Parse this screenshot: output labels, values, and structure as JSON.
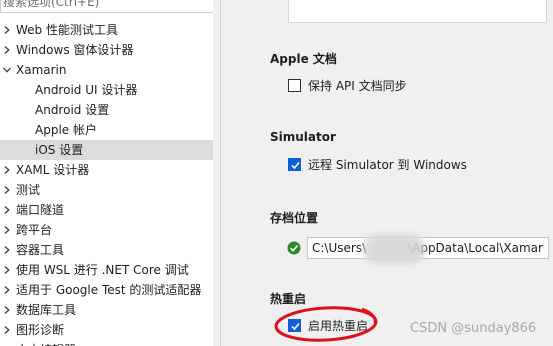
{
  "search": {
    "placeholder": "搜索选项(Ctrl+E)"
  },
  "tree": [
    {
      "label": "Web 性能测试工具",
      "expand": "collapsed",
      "level": 0
    },
    {
      "label": "Windows 窗体设计器",
      "expand": "collapsed",
      "level": 0
    },
    {
      "label": "Xamarin",
      "expand": "expanded",
      "level": 0
    },
    {
      "label": "Android UI 设计器",
      "expand": "none",
      "level": 1
    },
    {
      "label": "Android 设置",
      "expand": "none",
      "level": 1
    },
    {
      "label": "Apple 帐户",
      "expand": "none",
      "level": 1
    },
    {
      "label": "iOS 设置",
      "expand": "none",
      "level": 1,
      "selected": true
    },
    {
      "label": "XAML 设计器",
      "expand": "collapsed",
      "level": 0
    },
    {
      "label": "测试",
      "expand": "collapsed",
      "level": 0
    },
    {
      "label": "端口隧道",
      "expand": "collapsed",
      "level": 0
    },
    {
      "label": "跨平台",
      "expand": "collapsed",
      "level": 0
    },
    {
      "label": "容器工具",
      "expand": "collapsed",
      "level": 0
    },
    {
      "label": "使用 WSL 进行 .NET Core 调试",
      "expand": "collapsed",
      "level": 0
    },
    {
      "label": "适用于 Google Test 的测试适配器",
      "expand": "collapsed",
      "level": 0
    },
    {
      "label": "数据库工具",
      "expand": "collapsed",
      "level": 0
    },
    {
      "label": "图形诊断",
      "expand": "collapsed",
      "level": 0
    },
    {
      "label": "文本编辑器",
      "expand": "collapsed",
      "level": 0
    }
  ],
  "sections": {
    "apple_docs": {
      "title": "Apple 文档",
      "checkbox_label": "保持 API 文档同步",
      "checked": false
    },
    "simulator": {
      "title": "Simulator",
      "checkbox_label": "远程 Simulator 到 Windows",
      "checked": true
    },
    "archive": {
      "title": "存档位置",
      "path_value": "C:\\Users\\           \\AppData\\Local\\Xamar",
      "status_icon": "check-circle-icon"
    },
    "hot_restart": {
      "title": "热重启",
      "checkbox_label": "启用热重启",
      "checked": true
    }
  },
  "watermark": "CSDN @sunday866",
  "colors": {
    "accent": "#0e5fd8",
    "selected_row": "#dcdcde",
    "ok_green": "#2a8a2a",
    "annotation_red": "#e0101a"
  }
}
